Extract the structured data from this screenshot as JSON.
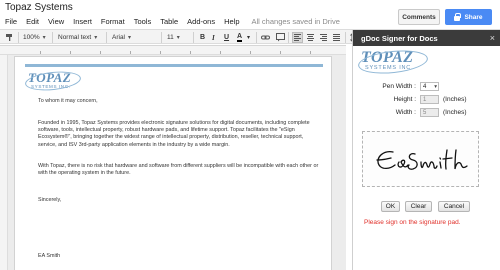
{
  "app": {
    "doc_title": "Topaz Systems",
    "menu": [
      "File",
      "Edit",
      "View",
      "Insert",
      "Format",
      "Tools",
      "Table",
      "Add-ons",
      "Help"
    ],
    "save_status": "All changes saved in Drive",
    "comments_label": "Comments",
    "share_label": "Share",
    "share_color": "#4a8af4"
  },
  "toolbar": {
    "zoom": "100%",
    "style": "Normal text",
    "font": "Arial",
    "size": "11",
    "bold": "B",
    "italic": "I",
    "underline": "U",
    "text_color": "A"
  },
  "document": {
    "logo_main": "TOPAZ",
    "logo_sub": "SYSTEMS INC.",
    "greeting": "To whom it may concern,",
    "para1": "Founded in 1995, Topaz Systems provides electronic signature solutions for digital documents, including complete software, tools, intellectual property, robust hardware pads, and lifetime support.  Topaz facilitates the \"eSign Ecosystem®\", bringing together the widest range of intellectual property, distribution, reseller, technical support, service, and ISV 3rd-party application elements in the industry by a wide margin.",
    "para2": "With Topaz, there is no risk that hardware and software from different suppliers will be incompatible with each other or with the operating system in the future.",
    "closing": "Sincerely,",
    "signer": "EA Smith",
    "accent_color": "#8fb7d6"
  },
  "panel": {
    "title": "gDoc Signer for Docs",
    "close": "×",
    "logo_main": "TOPAZ",
    "logo_sub": "SYSTEMS INC.",
    "pen_width_label": "Pen Width :",
    "pen_width_value": "4",
    "height_label": "Height :",
    "height_value": "1",
    "height_unit": "(Inches)",
    "width_label": "Width :",
    "width_value": "5",
    "width_unit": "(Inches)",
    "ok_label": "OK",
    "clear_label": "Clear",
    "cancel_label": "Cancel",
    "message": "Please sign on the signature pad.",
    "message_color": "#e0302a"
  }
}
